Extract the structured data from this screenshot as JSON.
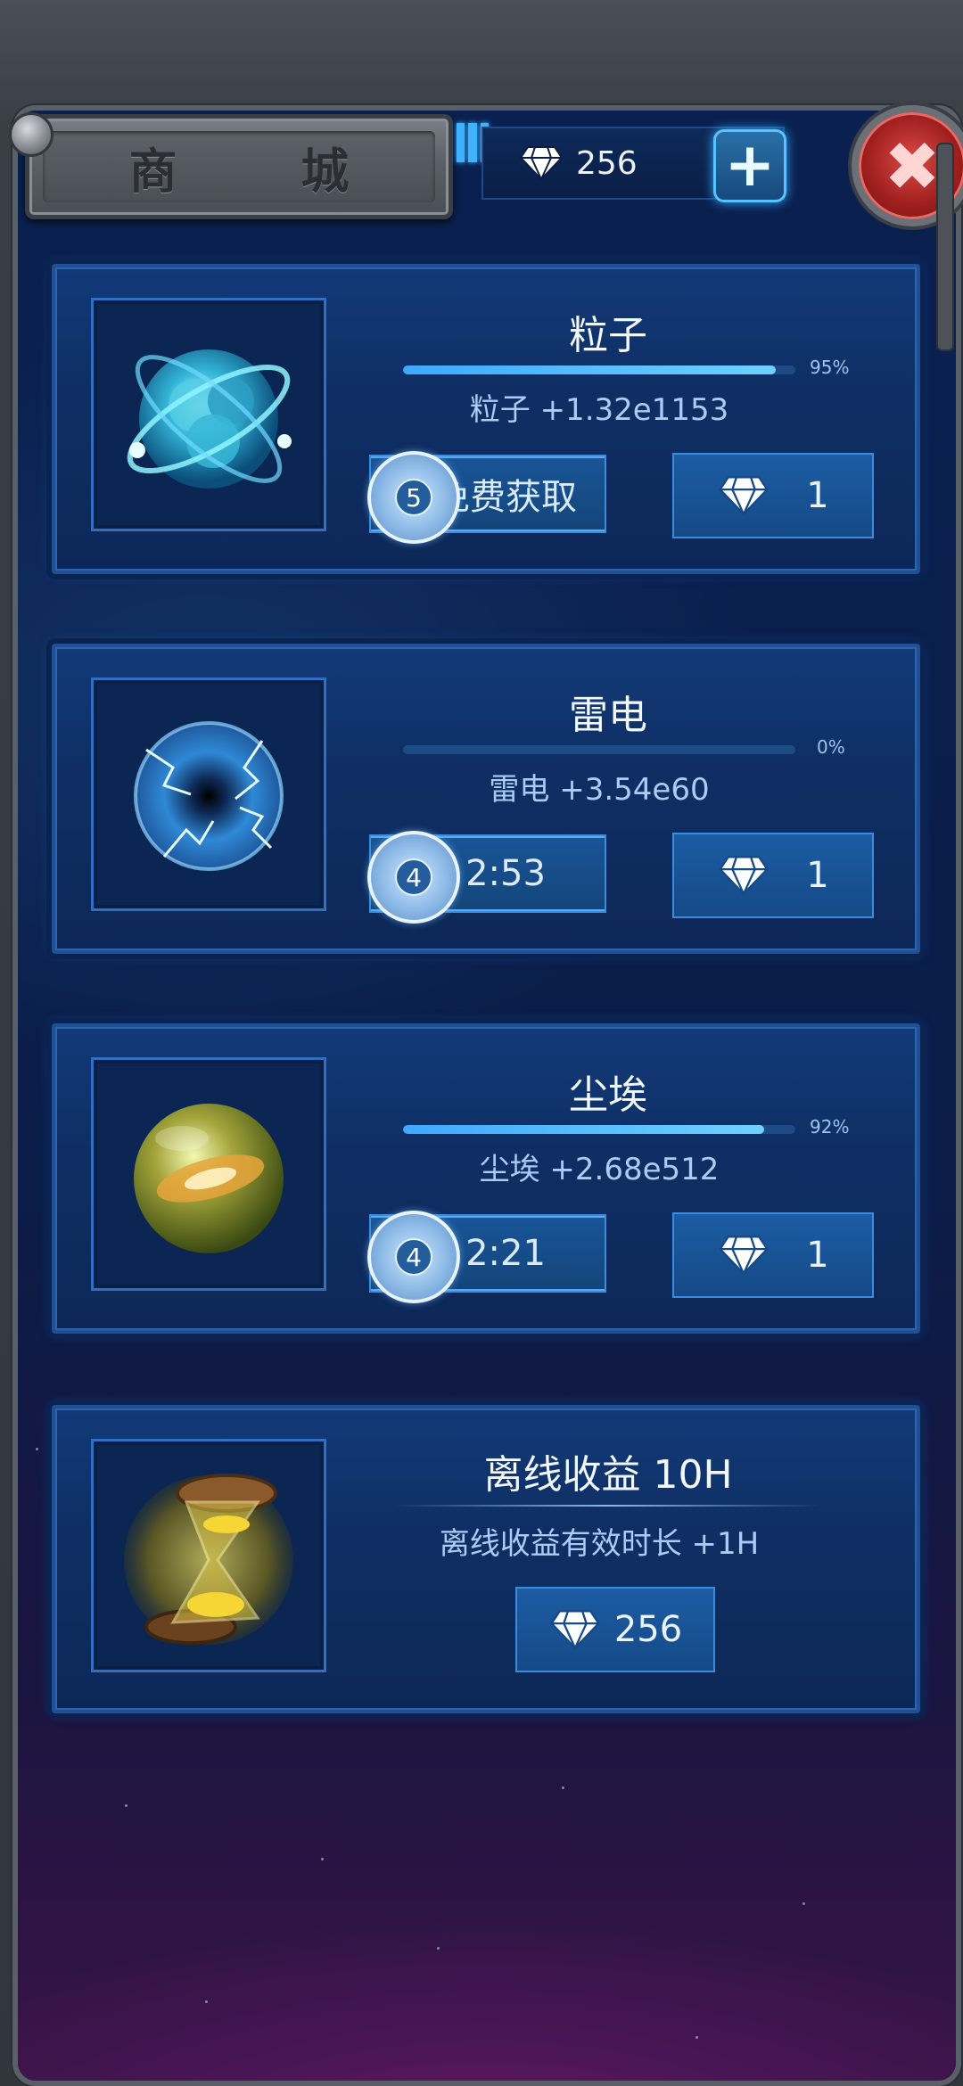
{
  "header": {
    "title": "商 城",
    "gem_count": "256",
    "plus_label": "+",
    "close_label": "✖"
  },
  "items": [
    {
      "name": "粒子",
      "progress": 95,
      "progress_label": "95%",
      "description": "粒子  +1.32e1153",
      "reel_count": "5",
      "video_label": "免费获取",
      "price": "1",
      "icon": "particle-orb-icon"
    },
    {
      "name": "雷电",
      "progress": 0,
      "progress_label": "0%",
      "description": "雷电  +3.54e60",
      "reel_count": "4",
      "video_label": "2:53",
      "price": "1",
      "icon": "lightning-orb-icon"
    },
    {
      "name": "尘埃",
      "progress": 92,
      "progress_label": "92%",
      "description": "尘埃  +2.68e512",
      "reel_count": "4",
      "video_label": "2:21",
      "price": "1",
      "icon": "dust-orb-icon"
    },
    {
      "name": "离线收益 10H",
      "description": "离线收益有效时长  +1H",
      "price": "256",
      "icon": "hourglass-icon"
    }
  ],
  "colors": {
    "accent": "#3fa9ff",
    "panel": "#0b1c3f",
    "close": "#a1201f"
  }
}
